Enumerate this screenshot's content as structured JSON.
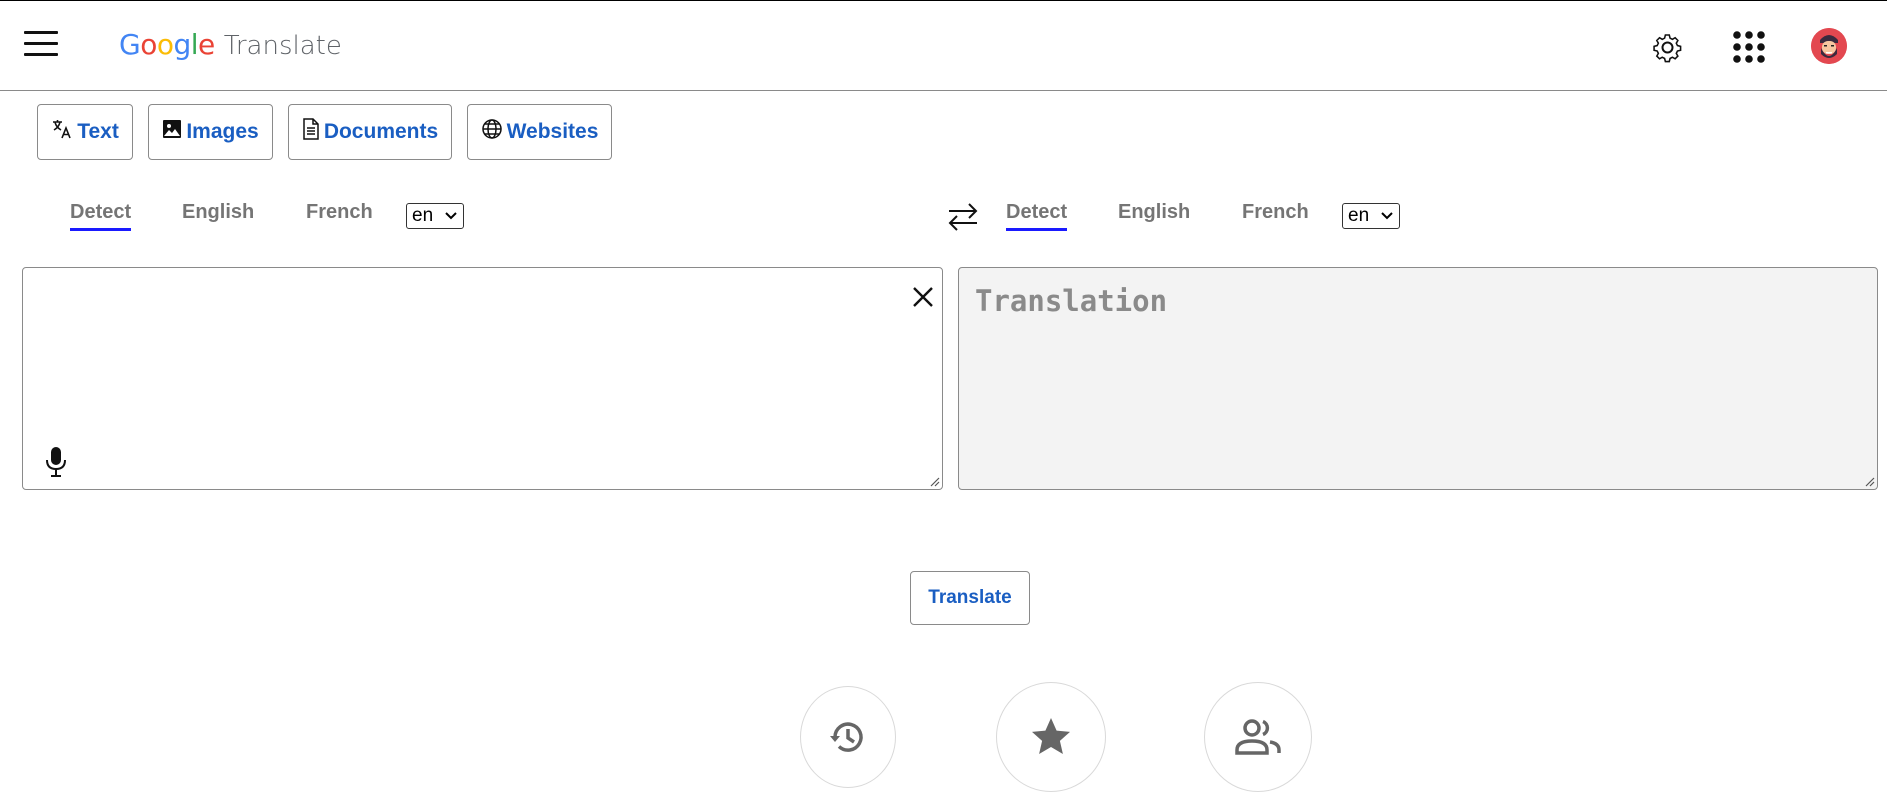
{
  "header": {
    "logo_letters": [
      "G",
      "o",
      "o",
      "g",
      "l",
      "e"
    ],
    "logo_colors": [
      "#4285F4",
      "#EA4335",
      "#FBBC05",
      "#4285F4",
      "#34A853",
      "#EA4335"
    ],
    "product_name": "Translate",
    "icons": [
      "menu-icon",
      "settings-icon",
      "apps-grid-icon",
      "avatar"
    ]
  },
  "modes": {
    "text": "Text",
    "images": "Images",
    "documents": "Documents",
    "websites": "Websites"
  },
  "source_lang": {
    "options": [
      "Detect",
      "English",
      "French"
    ],
    "active": "Detect",
    "select_value": "en"
  },
  "target_lang": {
    "options": [
      "Detect",
      "English",
      "French"
    ],
    "active": "Detect",
    "select_value": "en"
  },
  "source_text": "",
  "translation_placeholder": "Translation",
  "translate_button": "Translate",
  "bottom_actions": [
    "history-icon",
    "saved-star-icon",
    "community-icon"
  ],
  "colors": {
    "accent": "#1a5ec2",
    "active_underline": "#1a1aff",
    "avatar_bg": "#e34850"
  }
}
